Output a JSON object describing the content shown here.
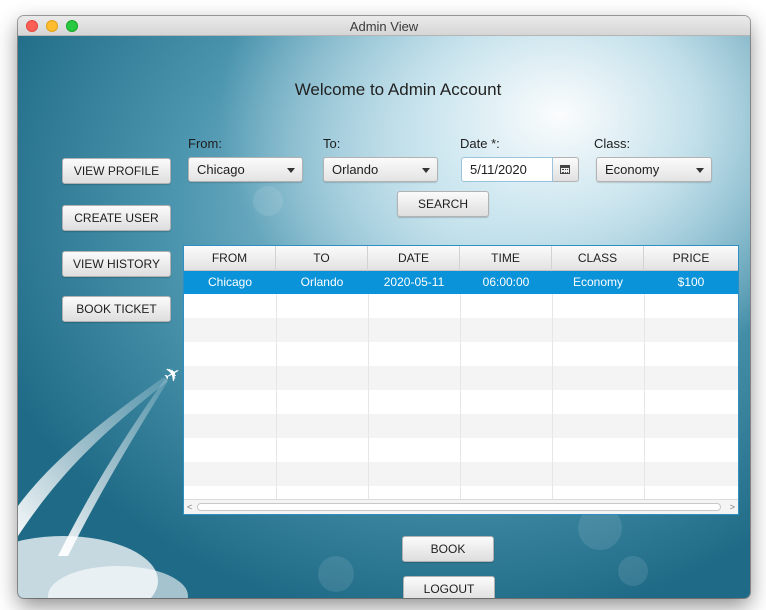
{
  "window": {
    "title": "Admin View"
  },
  "heading": "Welcome to Admin Account",
  "sidebar": {
    "buttons": [
      "VIEW PROFILE",
      "CREATE USER",
      "VIEW HISTORY",
      "BOOK TICKET"
    ]
  },
  "search": {
    "from_label": "From:",
    "from_value": "Chicago",
    "to_label": "To:",
    "to_value": "Orlando",
    "date_label": "Date *:",
    "date_value": "5/11/2020",
    "class_label": "Class:",
    "class_value": "Economy",
    "search_label": "SEARCH"
  },
  "table": {
    "columns": [
      "FROM",
      "TO",
      "DATE",
      "TIME",
      "CLASS",
      "PRICE"
    ],
    "rows": [
      [
        "Chicago",
        "Orlando",
        "2020-05-11",
        "06:00:00",
        "Economy",
        "$100"
      ]
    ]
  },
  "actions": {
    "book_label": "BOOK",
    "logout_label": "LOGOUT"
  },
  "icons": {
    "background": "airplane-contrail-icon",
    "date_picker": "calendar-icon",
    "dropdown": "chevron-down-icon"
  },
  "colors": {
    "selection": "#0a93d8",
    "table_border": "#2e8fc4"
  }
}
